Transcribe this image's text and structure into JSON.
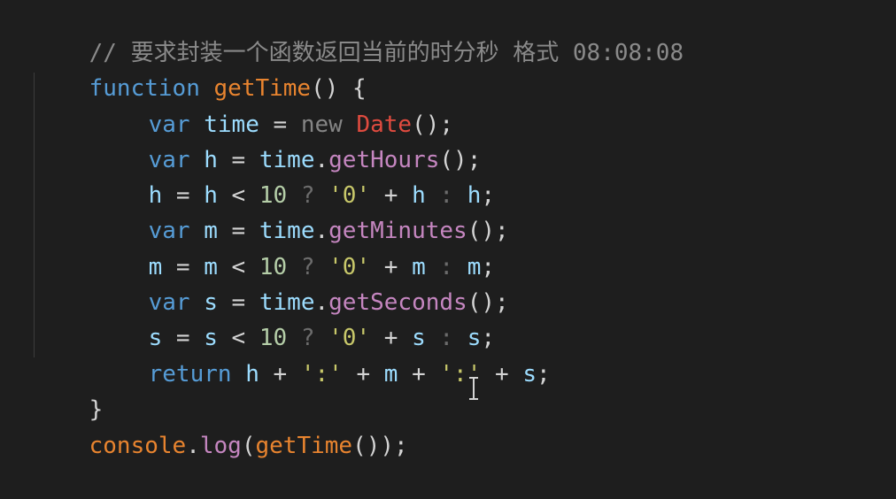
{
  "code": {
    "comment": "// 要求封装一个函数返回当前的时分秒 格式 08:08:08",
    "line_function": {
      "kw": "function",
      "name": "getTime",
      "rest": "() {"
    },
    "line_time": {
      "kw": "var",
      "name": "time",
      "eq": " = ",
      "new": "new",
      "cls": "Date",
      "end": "();"
    },
    "line_h": {
      "kw": "var",
      "name": "h",
      "eq": " = ",
      "obj": "time",
      "dot": ".",
      "method": "getHours",
      "end": "();"
    },
    "line_h_ternary": {
      "a": "h",
      "eq": " = ",
      "b": "h",
      "lt": " < ",
      "num": "10",
      "q": " ? ",
      "str": "'0'",
      "plus": " + ",
      "c": "h",
      "colon": " : ",
      "d": "h",
      "semi": ";"
    },
    "line_m": {
      "kw": "var",
      "name": "m",
      "eq": " = ",
      "obj": "time",
      "dot": ".",
      "method": "getMinutes",
      "end": "();"
    },
    "line_m_ternary": {
      "a": "m",
      "eq": " = ",
      "b": "m",
      "lt": " < ",
      "num": "10",
      "q": " ? ",
      "str": "'0'",
      "plus": " + ",
      "c": "m",
      "colon": " : ",
      "d": "m",
      "semi": ";"
    },
    "line_s": {
      "kw": "var",
      "name": "s",
      "eq": " = ",
      "obj": "time",
      "dot": ".",
      "method": "getSeconds",
      "end": "();"
    },
    "line_s_ternary": {
      "a": "s",
      "eq": " = ",
      "b": "s",
      "lt": " < ",
      "num": "10",
      "q": " ? ",
      "str": "'0'",
      "plus": " + ",
      "c": "s",
      "colon": " : ",
      "d": "s",
      "semi": ";"
    },
    "line_return": {
      "kw": "return",
      "h": "h",
      "p1": " + ",
      "s1": "':'",
      "p2": " + ",
      "m": "m",
      "p3": " + ",
      "s2": "':'",
      "p4": " + ",
      "s": "s",
      "semi": ";"
    },
    "line_close": "}",
    "line_console": {
      "obj": "console",
      "dot": ".",
      "method": "log",
      "open": "(",
      "call": "getTime",
      "end": "());"
    }
  },
  "colors": {
    "background": "#1e1e1e",
    "keyword": "#569cd6",
    "function_name": "#e8842f",
    "method": "#c586c0",
    "string": "#c8c86a",
    "class": "#e04b3f"
  },
  "icons": {
    "cursor": "text-cursor-icon"
  }
}
